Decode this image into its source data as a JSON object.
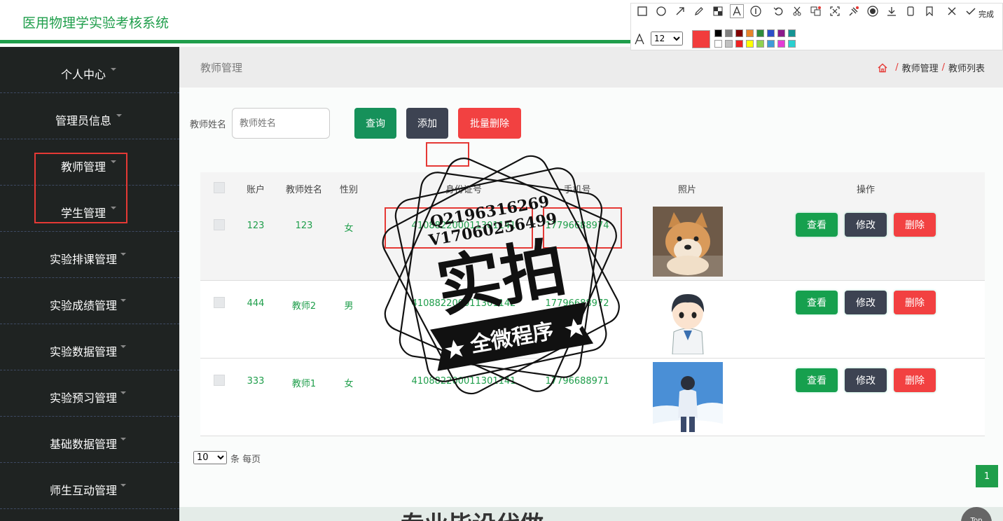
{
  "app": {
    "title": "医用物理学实验考核系统"
  },
  "sidebar": {
    "items": [
      {
        "label": "个人中心"
      },
      {
        "label": "管理员信息"
      },
      {
        "label": "教师管理"
      },
      {
        "label": "学生管理"
      },
      {
        "label": "实验排课管理"
      },
      {
        "label": "实验成绩管理"
      },
      {
        "label": "实验数据管理"
      },
      {
        "label": "实验预习管理"
      },
      {
        "label": "基础数据管理"
      },
      {
        "label": "师生互动管理"
      }
    ]
  },
  "content": {
    "page_title": "教师管理",
    "breadcrumb": [
      "教师管理",
      "教师列表"
    ]
  },
  "search": {
    "label": "教师姓名",
    "placeholder": "教师姓名",
    "query_label": "查询",
    "add_label": "添加",
    "batch_delete_label": "批量删除"
  },
  "table": {
    "columns": [
      "账户",
      "教师姓名",
      "性别",
      "身份证号",
      "手机号",
      "照片",
      "操作"
    ],
    "rows": [
      {
        "account": "123",
        "name": "123",
        "gender": "女",
        "id_card": "410882200011301141",
        "phone": "17796688974",
        "photo_icon": "shiba-dog-photo"
      },
      {
        "account": "444",
        "name": "教师2",
        "gender": "男",
        "id_card": "410882200011301142",
        "phone": "17796688972",
        "photo_icon": "cartoon-doctor-photo"
      },
      {
        "account": "333",
        "name": "教师1",
        "gender": "女",
        "id_card": "410882200011301141",
        "phone": "17796688971",
        "photo_icon": "anime-boy-sky-photo"
      }
    ],
    "actions": {
      "view": "查看",
      "edit": "修改",
      "delete": "删除"
    }
  },
  "pagination": {
    "page_size": "10",
    "page_size_suffix": "条 每页",
    "current_page": "1"
  },
  "footer": {
    "text": "专业毕设代做",
    "top_label": "Top"
  },
  "toolbar": {
    "font_size": "12",
    "done_label": "完成",
    "selected_color": "#f13c3c",
    "palette": [
      "#000000",
      "#808080",
      "#800000",
      "#e8832a",
      "#2e8b3c",
      "#2c4fc9",
      "#8b1a8b",
      "#149494",
      "#ffffff",
      "#c0c0c0",
      "#ee2222",
      "#ffff00",
      "#8fd14f",
      "#3f9bd8",
      "#e33cd6",
      "#2bd0d0"
    ]
  },
  "watermark": {
    "line1": "Q2196316269",
    "line2": "V17060256499",
    "main": "实拍",
    "sub": "全微程序"
  },
  "colors": {
    "brand_green": "#1f9e4b",
    "sidebar_bg": "#1f2322",
    "danger": "#f24141",
    "dark_btn": "#3d4352"
  }
}
